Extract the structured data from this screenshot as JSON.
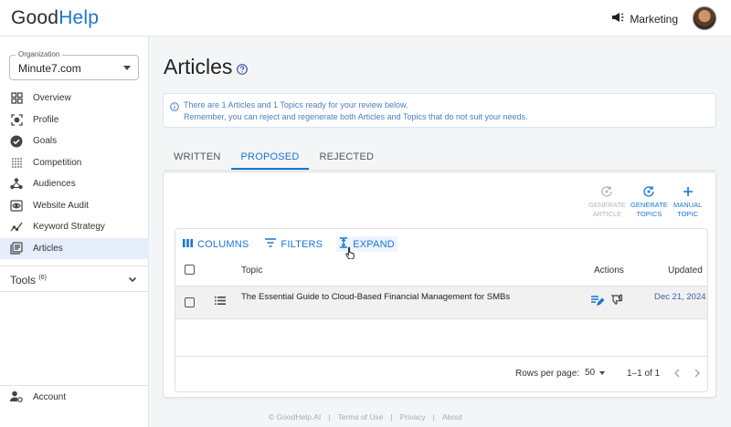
{
  "brand": {
    "part1": "Good",
    "part2": "Help"
  },
  "header": {
    "team_label": "Marketing"
  },
  "sidebar": {
    "org_legend": "Organization",
    "org_value": "Minute7.com",
    "items": [
      {
        "label": "Overview",
        "icon": "grid-icon"
      },
      {
        "label": "Profile",
        "icon": "profile-scan-icon"
      },
      {
        "label": "Goals",
        "icon": "check-circle-icon"
      },
      {
        "label": "Competition",
        "icon": "dots-grid-icon"
      },
      {
        "label": "Audiences",
        "icon": "audiences-icon"
      },
      {
        "label": "Website Audit",
        "icon": "eye-window-icon"
      },
      {
        "label": "Keyword Strategy",
        "icon": "trend-chart-icon"
      },
      {
        "label": "Articles",
        "icon": "articles-icon",
        "active": true
      }
    ],
    "tools_label": "Tools",
    "tools_count": "(6)",
    "account_label": "Account"
  },
  "main": {
    "title": "Articles",
    "alert_line1": "There are 1 Articles and 1 Topics ready for your review below.",
    "alert_line2": "Remember, you can reject and regenerate both Articles and Topics that do not suit your needs.",
    "tabs": [
      "WRITTEN",
      "PROPOSED",
      "REJECTED"
    ],
    "active_tab": "PROPOSED",
    "actions": {
      "generate_article_1": "GENERATE",
      "generate_article_2": "ARTICLE",
      "generate_topics_1": "GENERATE",
      "generate_topics_2": "TOPICS",
      "manual_topic_1": "MANUAL",
      "manual_topic_2": "TOPIC"
    },
    "toolbar": {
      "columns": "COLUMNS",
      "filters": "FILTERS",
      "expand": "EXPAND"
    },
    "table": {
      "headers": {
        "topic": "Topic",
        "actions": "Actions",
        "updated": "Updated"
      },
      "rows": [
        {
          "topic": "The Essential Guide to Cloud-Based Financial Management for SMBs",
          "updated": "Dec 21, 2024"
        }
      ]
    },
    "pagination": {
      "rows_label": "Rows per page:",
      "rows_value": "50",
      "range": "1–1 of 1"
    }
  },
  "footer": {
    "copyright": "© GoodHelp.AI",
    "terms": "Terms of Use",
    "privacy": "Privacy",
    "about": "About"
  },
  "colors": {
    "accent": "#1976d2",
    "active_bg": "#e6eefc"
  }
}
